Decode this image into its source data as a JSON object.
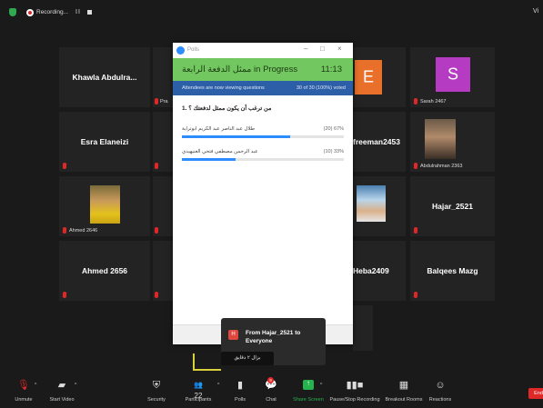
{
  "topbar": {
    "recording_label": "Recording...",
    "pause_label": "II",
    "view_label": "Vi"
  },
  "tiles": {
    "khawla": "Khawla Abdulra...",
    "e_avatar_letter": "E",
    "s_avatar_letter": "S",
    "sarah": "Sarah 2467",
    "esra": "Esra Elaneizi",
    "freeman": "freeman2453",
    "abdulrahman": "Abdulrahman 2363",
    "ahmed2646": "Ahmed 2646",
    "hajar": "Hajar_2521",
    "ahmed2656": "Ahmed 2656",
    "heba": "Heba2409",
    "balqees": "Balqees Mazg",
    "pra_partial": "Pra",
    "bottom_partial": "Ahm"
  },
  "poll": {
    "window_title": "Polls",
    "status": "in Progress",
    "title_ar": "ممثل الدفعة الرابعة",
    "time": "11:13",
    "attendees_text": "Attendees are now viewing questions",
    "voted_text": "30 of 30 (100%) voted",
    "question": "1. من ترغب أن يكون ممثل لدفعتك ؟",
    "options": [
      {
        "label": "طلال عبد الناصر عبد الكريم ابوتراية",
        "result": "(20) 67%",
        "fraction": 0.67
      },
      {
        "label": "عبد الرحمن مصطفي فتحي الغنيهيدي",
        "result": "(10) 33%",
        "fraction": 0.33
      }
    ]
  },
  "chat_notification": {
    "avatar_letter": "H",
    "from_text": "From Hajar_2521 to Everyone",
    "message": "بزال ٢ دقايق"
  },
  "toolbar": {
    "unmute": "Unmute",
    "start_video": "Start Video",
    "security": "Security",
    "participants": "Participants",
    "participants_count": "22",
    "polls": "Polls",
    "chat": "Chat",
    "chat_badge": "9",
    "share_screen": "Share Screen",
    "pause_stop_recording": "Pause/Stop Recording",
    "breakout_rooms": "Breakout Rooms",
    "reactions": "Reactions",
    "end": "End"
  },
  "colors": {
    "poll_header": "#72c760",
    "poll_subbar": "#2d5fa8",
    "bar_fill": "#2d8cff",
    "share_green": "#25b34d",
    "end_red": "#e02828"
  }
}
